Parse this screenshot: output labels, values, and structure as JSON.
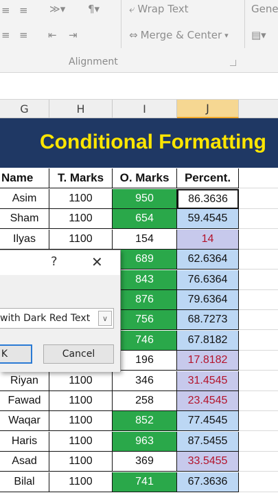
{
  "ribbon": {
    "wrap_text": "Wrap Text",
    "merge_center": "Merge & Center",
    "number_format": "Gener",
    "group_alignment": "Alignment"
  },
  "columns": [
    "G",
    "H",
    "I",
    "J"
  ],
  "banner": {
    "title": "Conditional Formatting"
  },
  "table": {
    "headers": [
      "Name",
      "T. Marks",
      "O. Marks",
      "Percent."
    ],
    "rows": [
      {
        "name": "Asim",
        "total": "1100",
        "obtained": "950",
        "percent": "86.3636",
        "green": true,
        "red": false
      },
      {
        "name": "Sham",
        "total": "1100",
        "obtained": "654",
        "percent": "59.4545",
        "green": true,
        "red": false
      },
      {
        "name": "Ilyas",
        "total": "1100",
        "obtained": "154",
        "percent": "14",
        "green": false,
        "red": true
      },
      {
        "name": "",
        "total": "",
        "obtained": "689",
        "percent": "62.6364",
        "green": true,
        "red": false
      },
      {
        "name": "",
        "total": "",
        "obtained": "843",
        "percent": "76.6364",
        "green": true,
        "red": false
      },
      {
        "name": "",
        "total": "",
        "obtained": "876",
        "percent": "79.6364",
        "green": true,
        "red": false
      },
      {
        "name": "",
        "total": "",
        "obtained": "756",
        "percent": "68.7273",
        "green": true,
        "red": false
      },
      {
        "name": "",
        "total": "",
        "obtained": "746",
        "percent": "67.8182",
        "green": true,
        "red": false
      },
      {
        "name": "",
        "total": "",
        "obtained": "196",
        "percent": "17.8182",
        "green": false,
        "red": true
      },
      {
        "name": "Riyan",
        "total": "1100",
        "obtained": "346",
        "percent": "31.4545",
        "green": false,
        "red": true
      },
      {
        "name": "Fawad",
        "total": "1100",
        "obtained": "258",
        "percent": "23.4545",
        "green": false,
        "red": true
      },
      {
        "name": "Waqar",
        "total": "1100",
        "obtained": "852",
        "percent": "77.4545",
        "green": true,
        "red": false
      },
      {
        "name": "Haris",
        "total": "1100",
        "obtained": "963",
        "percent": "87.5455",
        "green": true,
        "red": false
      },
      {
        "name": "Asad",
        "total": "1100",
        "obtained": "369",
        "percent": "33.5455",
        "green": false,
        "red": true
      },
      {
        "name": "Bilal",
        "total": "1100",
        "obtained": "741",
        "percent": "67.3636",
        "green": true,
        "red": false
      }
    ]
  },
  "dialog": {
    "help": "?",
    "close": "✕",
    "format_option": "with Dark Red Text",
    "ok_label": "K",
    "cancel_label": "Cancel"
  },
  "colors": {
    "banner_bg": "#1f3864",
    "banner_text": "#ffe600",
    "green_fill": "#2aa84a",
    "percent_fill": "#bcd7f4",
    "dark_red_text": "#b3132b"
  }
}
